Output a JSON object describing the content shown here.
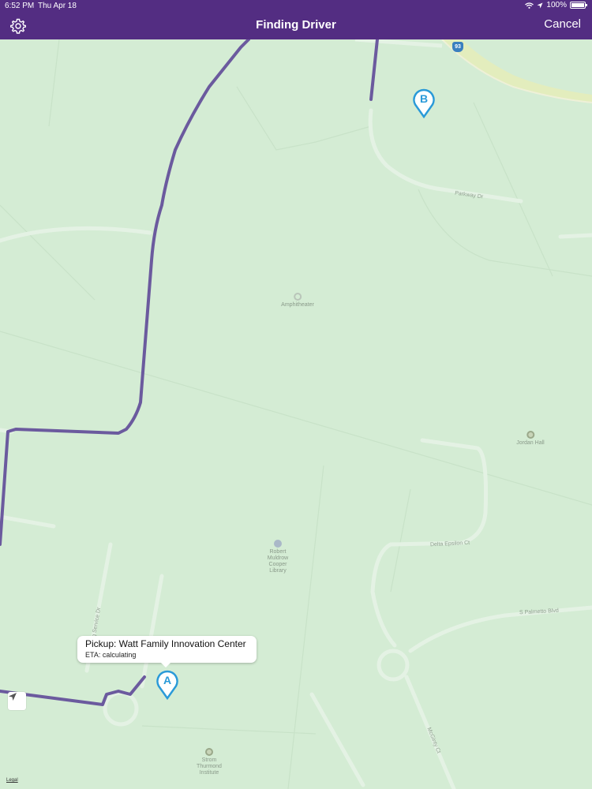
{
  "status_bar": {
    "time": "6:52 PM",
    "date": "Thu Apr 18",
    "battery": "100%"
  },
  "header": {
    "title": "Finding Driver",
    "cancel_label": "Cancel",
    "settings_icon": "gear-icon"
  },
  "map": {
    "pois": {
      "amphitheater": "Amphitheater",
      "jordan_hall": "Jordan Hall",
      "library": "Robert Muldrow Cooper Library",
      "strom": "Strom Thurmond Institute"
    },
    "streets": {
      "parkway": "Parkway Dr",
      "delta_epsilon": "Delta Epsilon Ct",
      "palmetto": "S Palmetto Blvd",
      "mcginty": "McGinty Ct",
      "service": "ing Service Dr"
    },
    "route_shield": "93",
    "legal_label": "Legal",
    "route_color": "#6b5a9e"
  },
  "pins": {
    "pickup_letter": "A",
    "dropoff_letter": "B",
    "pin_color": "#2a9ad8"
  },
  "callout": {
    "title": "Pickup: Watt Family Innovation Center",
    "eta": "ETA: calculating"
  }
}
